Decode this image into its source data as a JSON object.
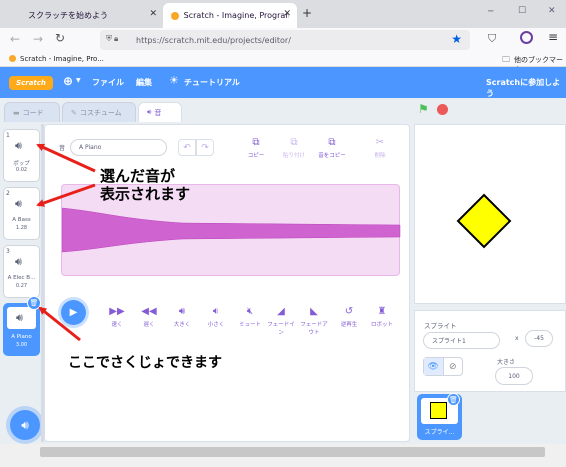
{
  "browser": {
    "tabs": [
      {
        "label": "スクラッチを始めよう"
      },
      {
        "label": "Scratch - Imagine, Program, Sh"
      }
    ],
    "new_tab": "+",
    "window_controls": [
      "─",
      "☐",
      "✕"
    ],
    "url": "https://scratch.mit.edu/projects/editor/",
    "bookmark": "Scratch - Imagine, Pro...",
    "other_bookmarks": "他のブックマーク"
  },
  "menu": {
    "logo": "Scratch",
    "file": "ファイル",
    "edit": "編集",
    "tutorial": "チュートリアル",
    "join": "Scratchに参加しよう"
  },
  "editor_tabs": {
    "code": "コード",
    "costume": "コスチューム",
    "sound": "音"
  },
  "sounds": [
    {
      "num": "1",
      "name": "ポップ",
      "duration": "0.02",
      "selected": false
    },
    {
      "num": "2",
      "name": "A Bass",
      "duration": "1.28",
      "selected": false
    },
    {
      "num": "3",
      "name": "A Elec B...",
      "duration": "0.27",
      "selected": false
    },
    {
      "num": "4",
      "name": "A Piano",
      "duration": "3.00",
      "selected": true
    }
  ],
  "sound_editor": {
    "name_label": "音",
    "name_value": "A Piano",
    "tools": {
      "copy": "コピー",
      "paste": "貼り付け",
      "copy_new": "音をコピー",
      "delete": "削除"
    },
    "effects": [
      "速く",
      "遅く",
      "大きく",
      "小さく",
      "ミュート",
      "フェードイン",
      "フェードアウト",
      "逆再生",
      "ロボット"
    ]
  },
  "sprite_info": {
    "label": "スプライト",
    "name": "スプライト1",
    "x_label": "x",
    "x_value": "-45",
    "size_label": "大きさ",
    "size_value": "100"
  },
  "sprite_list": {
    "thumb_label": "スプライ..."
  },
  "annotations": {
    "top": "選んだ音が\n表示されます",
    "bottom": "ここでさくじょできます"
  },
  "colors": {
    "brand_blue": "#4c97ff",
    "sound_purple": "#cf63cf",
    "waveform_fill": "#f5dcf5",
    "arrow_red": "#e8201a",
    "sprite_yellow": "#ffff00"
  }
}
